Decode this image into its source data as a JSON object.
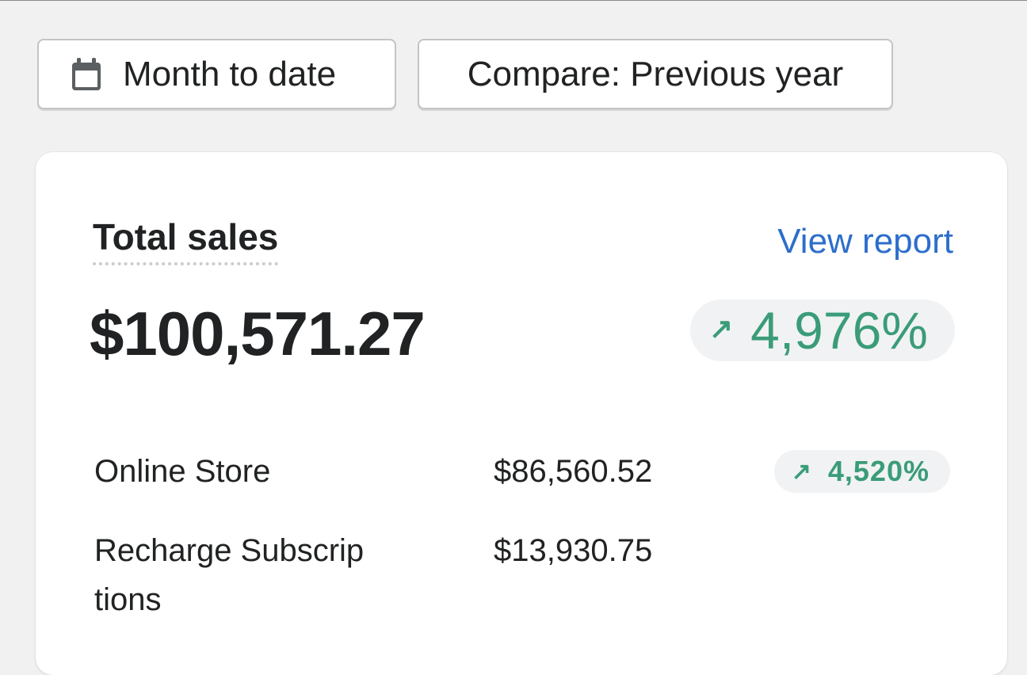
{
  "toolbar": {
    "date_range_label": "Month to date",
    "compare_label": "Compare: Previous year"
  },
  "card": {
    "title": "Total sales",
    "view_report_label": "View report",
    "total_value": "$100,571.27",
    "total_change": "4,976%",
    "rows": [
      {
        "label": "Online Store",
        "value": "$86,560.52",
        "change": "4,520%"
      },
      {
        "label": "Recharge Subscrip tions",
        "value": "$13,930.75"
      }
    ]
  },
  "icons": {
    "calendar": "calendar-icon",
    "trend_up": "arrow-up-right-icon"
  },
  "colors": {
    "page_bg": "#f1f1f1",
    "card_bg": "#ffffff",
    "link": "#2c6ecb",
    "positive": "#3a9c78",
    "pill_bg": "#f1f2f3",
    "text": "#202223"
  }
}
